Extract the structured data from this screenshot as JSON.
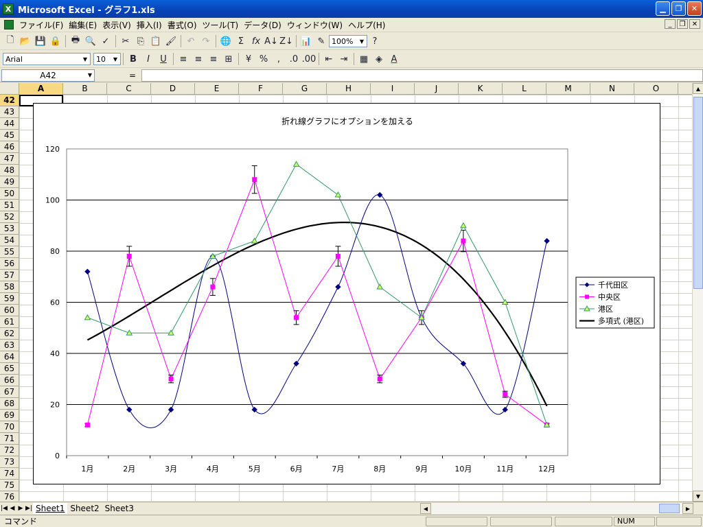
{
  "window": {
    "title": "Microsoft Excel - グラフ1.xls"
  },
  "menubar": {
    "items": [
      "ファイル(F)",
      "編集(E)",
      "表示(V)",
      "挿入(I)",
      "書式(O)",
      "ツール(T)",
      "データ(D)",
      "ウィンドウ(W)",
      "ヘルプ(H)"
    ]
  },
  "toolbar1": {
    "zoom": "100%"
  },
  "toolbar2": {
    "font": "Arial",
    "size": "10"
  },
  "formula": {
    "name_box": "A42",
    "equals": "="
  },
  "columns": [
    "A",
    "B",
    "C",
    "D",
    "E",
    "F",
    "G",
    "H",
    "I",
    "J",
    "K",
    "L",
    "M",
    "N",
    "O"
  ],
  "rows": [
    "42",
    "43",
    "44",
    "45",
    "46",
    "47",
    "48",
    "49",
    "50",
    "51",
    "52",
    "53",
    "54",
    "55",
    "56",
    "57",
    "58",
    "59",
    "60",
    "61",
    "62",
    "63",
    "64",
    "65",
    "66",
    "67",
    "68",
    "69",
    "70",
    "71",
    "72",
    "73",
    "74",
    "75",
    "76"
  ],
  "sheets": {
    "tabs": [
      "Sheet1",
      "Sheet2",
      "Sheet3"
    ]
  },
  "status": {
    "text": "コマンド",
    "num": "NUM"
  },
  "chart_data": {
    "type": "line",
    "title": "折れ線グラフにオプションを加える",
    "categories": [
      "1月",
      "2月",
      "3月",
      "4月",
      "5月",
      "6月",
      "7月",
      "8月",
      "9月",
      "10月",
      "11月",
      "12月"
    ],
    "ylim": [
      0,
      120
    ],
    "yticks": [
      "0",
      "20",
      "40",
      "60",
      "80",
      "100",
      "120"
    ],
    "grid": true,
    "legend": "right",
    "series": [
      {
        "name": "千代田区",
        "color": "#000080",
        "marker": "diamond",
        "smooth": true,
        "values": [
          72,
          18,
          18,
          78,
          18,
          36,
          66,
          102,
          54,
          36,
          18,
          84
        ]
      },
      {
        "name": "中央区",
        "color": "#ff00ff",
        "marker": "square",
        "smooth": false,
        "error_bars": true,
        "values": [
          12,
          78,
          30,
          66,
          108,
          54,
          78,
          30,
          54,
          84,
          24,
          12
        ]
      },
      {
        "name": "港区",
        "color": "#339966",
        "marker": "triangle",
        "marker_fill": "#ccff66",
        "smooth": false,
        "values": [
          54,
          48,
          48,
          78,
          84,
          114,
          102,
          66,
          54,
          90,
          60,
          12
        ]
      }
    ],
    "trendline": {
      "name": "多項式 (港区)",
      "type": "polynomial",
      "of": "港区",
      "color": "#000000"
    }
  }
}
